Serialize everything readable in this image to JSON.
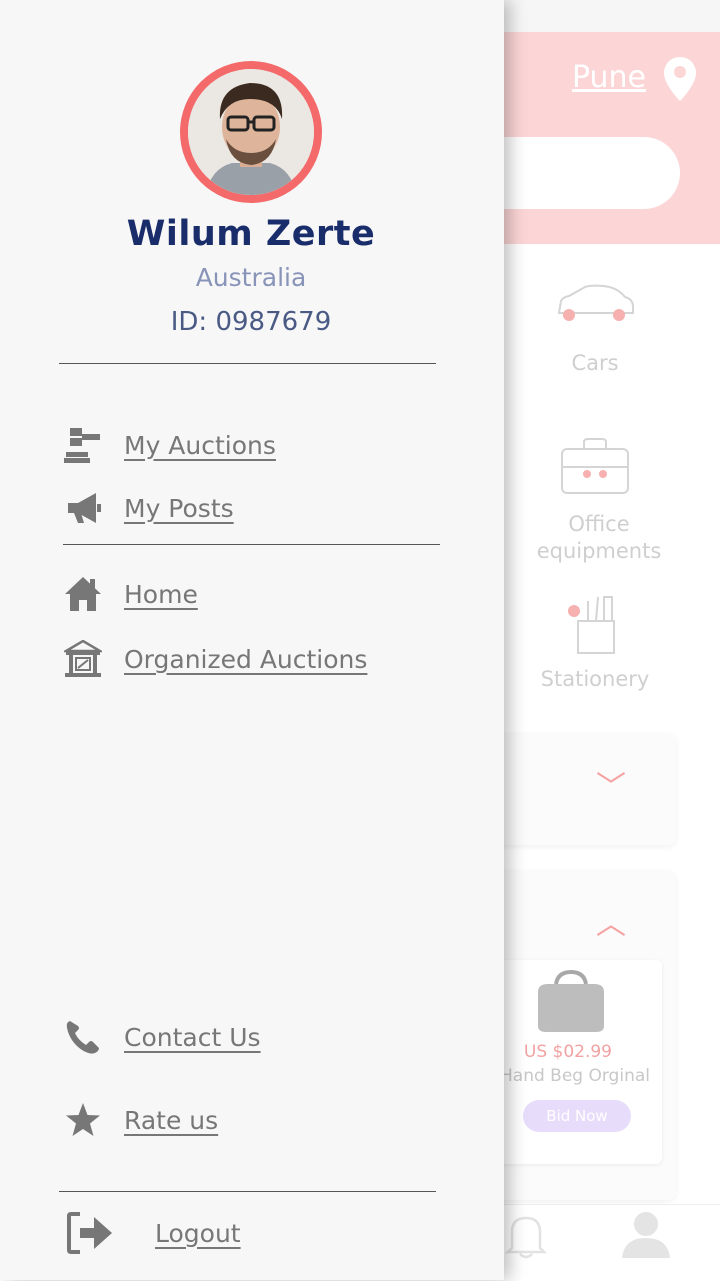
{
  "background": {
    "location": "Pune",
    "categories": [
      {
        "label": "Cars",
        "icon": "car-icon"
      },
      {
        "label": "Office equipments",
        "icon": "briefcase-icon"
      },
      {
        "label": "Stationery",
        "icon": "stationery-icon"
      }
    ],
    "product": {
      "price": "US $02.99",
      "name": "Hand Beg Orginal",
      "bid_label": "Bid Now"
    }
  },
  "drawer": {
    "profile": {
      "name": "Wilum Zerte",
      "country": "Australia",
      "id_text": "ID: 0987679"
    },
    "menu_primary": [
      {
        "label": "My Auctions",
        "icon": "gavel-icon"
      },
      {
        "label": "My Posts",
        "icon": "megaphone-icon"
      }
    ],
    "menu_secondary": [
      {
        "label": "Home",
        "icon": "home-icon"
      },
      {
        "label": "Organized Auctions",
        "icon": "auction-house-icon"
      }
    ],
    "menu_footer": [
      {
        "label": "Contact Us",
        "icon": "phone-icon"
      },
      {
        "label": "Rate us",
        "icon": "star-icon"
      }
    ],
    "logout_label": "Logout"
  },
  "colors": {
    "accent": "#f46a6a",
    "name_color": "#1a2d6b",
    "menu_text": "#777777"
  }
}
